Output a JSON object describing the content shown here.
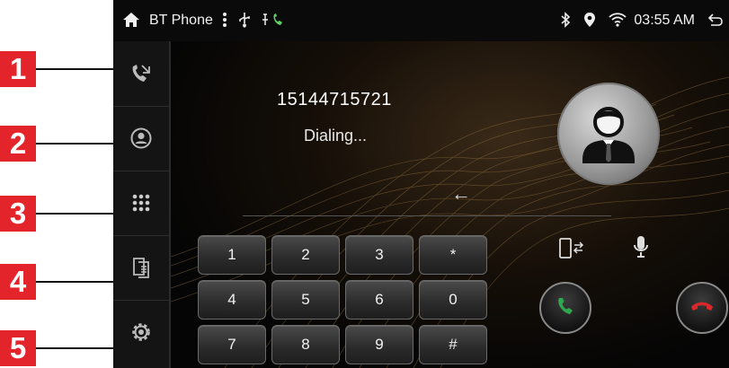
{
  "callouts": [
    "1",
    "2",
    "3",
    "4",
    "5"
  ],
  "status_bar": {
    "app_title": "BT Phone",
    "time": "03:55 AM",
    "icons": [
      "home-icon",
      "menu-dots-icon",
      "usb-icon",
      "phone-status-icon",
      "bluetooth-icon",
      "location-icon",
      "wifi-icon",
      "back-icon"
    ]
  },
  "sidebar": {
    "items": [
      {
        "name": "call-log",
        "icon": "call-log-icon"
      },
      {
        "name": "contacts",
        "icon": "contacts-icon"
      },
      {
        "name": "dialpad",
        "icon": "dialpad-icon"
      },
      {
        "name": "phonebook-sync",
        "icon": "phonebook-icon"
      },
      {
        "name": "settings",
        "icon": "gear-icon"
      }
    ]
  },
  "dialer": {
    "number": "15144715721",
    "status": "Dialing...",
    "backspace": "←",
    "keys": [
      "1",
      "2",
      "3",
      "*",
      "4",
      "5",
      "6",
      "0",
      "7",
      "8",
      "9",
      "#"
    ]
  },
  "colors": {
    "callout_red": "#e3252b",
    "answer_green": "#2fa84f",
    "hangup_red": "#d8282b"
  }
}
